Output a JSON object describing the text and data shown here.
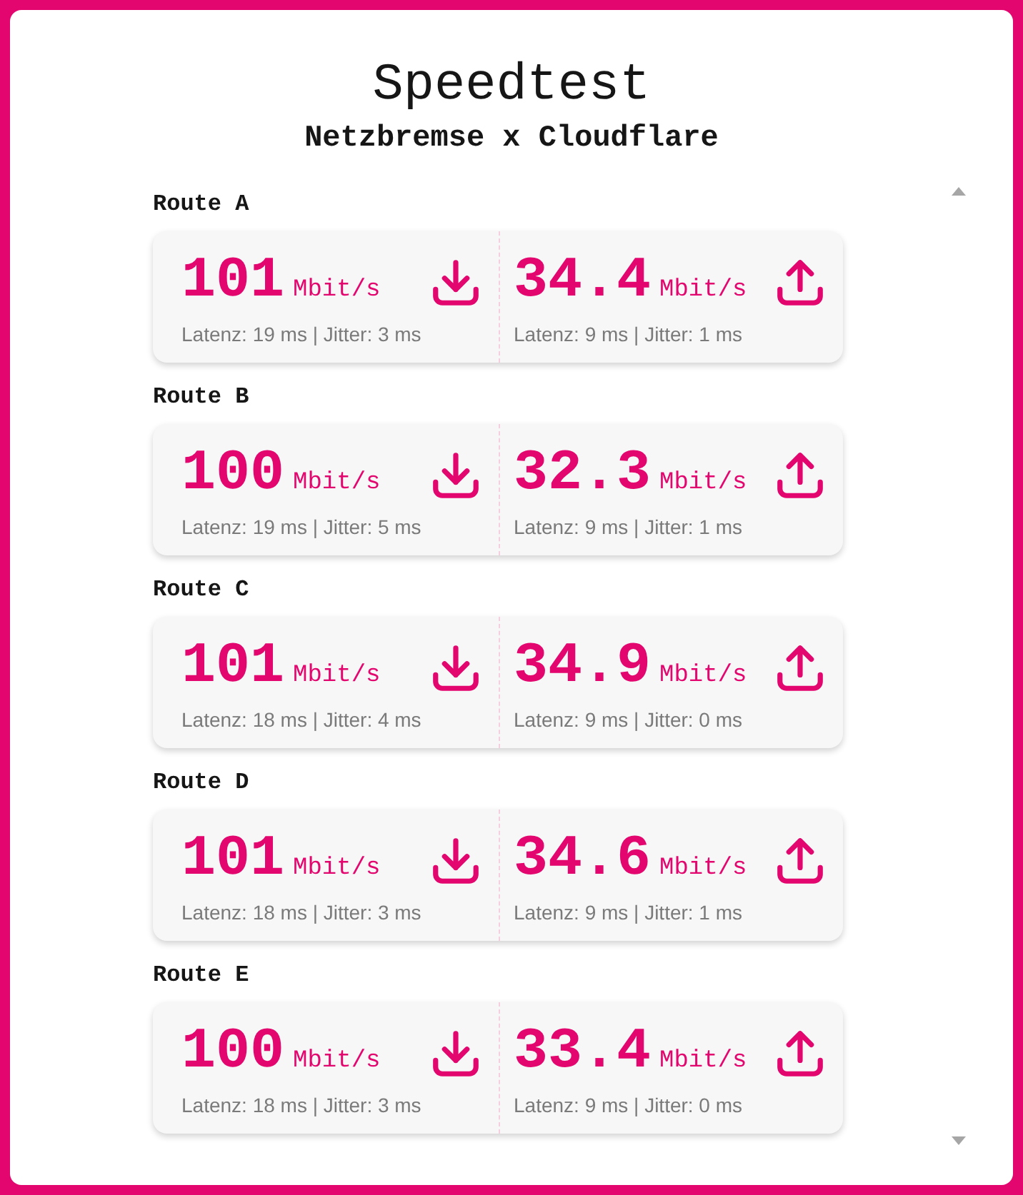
{
  "title": "Speedtest",
  "subtitle": "Netzbremse x Cloudflare",
  "routes": [
    {
      "name": "Route A",
      "results": [
        {
          "kind": "download",
          "speed": "101",
          "unit": "Mbit/s",
          "stats": "Latenz: 19 ms | Jitter: 3 ms"
        },
        {
          "kind": "upload",
          "speed": "34.4",
          "unit": "Mbit/s",
          "stats": "Latenz: 9 ms | Jitter: 1 ms"
        }
      ]
    },
    {
      "name": "Route B",
      "results": [
        {
          "kind": "download",
          "speed": "100",
          "unit": "Mbit/s",
          "stats": "Latenz: 19 ms | Jitter: 5 ms"
        },
        {
          "kind": "upload",
          "speed": "32.3",
          "unit": "Mbit/s",
          "stats": "Latenz: 9 ms | Jitter: 1 ms"
        }
      ]
    },
    {
      "name": "Route C",
      "results": [
        {
          "kind": "download",
          "speed": "101",
          "unit": "Mbit/s",
          "stats": "Latenz: 18 ms | Jitter: 4 ms"
        },
        {
          "kind": "upload",
          "speed": "34.9",
          "unit": "Mbit/s",
          "stats": "Latenz: 9 ms | Jitter: 0 ms"
        }
      ]
    },
    {
      "name": "Route D",
      "results": [
        {
          "kind": "download",
          "speed": "101",
          "unit": "Mbit/s",
          "stats": "Latenz: 18 ms | Jitter: 3 ms"
        },
        {
          "kind": "upload",
          "speed": "34.6",
          "unit": "Mbit/s",
          "stats": "Latenz: 9 ms | Jitter: 1 ms"
        }
      ]
    },
    {
      "name": "Route E",
      "results": [
        {
          "kind": "download",
          "speed": "100",
          "unit": "Mbit/s",
          "stats": "Latenz: 18 ms | Jitter: 3 ms"
        },
        {
          "kind": "upload",
          "speed": "33.4",
          "unit": "Mbit/s",
          "stats": "Latenz: 9 ms | Jitter: 0 ms"
        }
      ]
    }
  ]
}
